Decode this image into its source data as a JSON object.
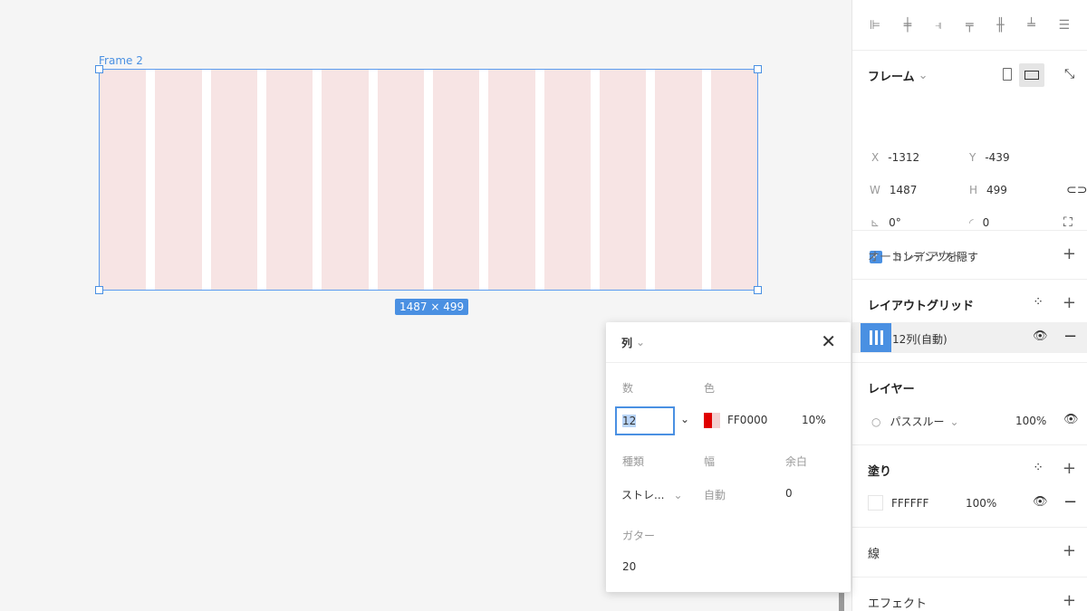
{
  "canvas": {
    "frame_name": "Frame 2",
    "dimensions": "1487 × 499",
    "columns": 12
  },
  "align_icons": [
    "align-left-icon",
    "align-center-h-icon",
    "align-right-icon",
    "align-top-icon",
    "align-center-v-icon",
    "align-bottom-icon",
    "distribute-icon"
  ],
  "frame_section": {
    "title": "フレーム",
    "x_label": "X",
    "x": "-1312",
    "y_label": "Y",
    "y": "-439",
    "w_label": "W",
    "w": "1487",
    "h_label": "H",
    "h": "499",
    "rotation": "0°",
    "radius": "0",
    "clip_label": "コンテンツを隠す"
  },
  "auto_layout": {
    "title": "オートレイアウト"
  },
  "layout_grid": {
    "title": "レイアウトグリッド",
    "item": "12列(自動)"
  },
  "layer": {
    "title": "レイヤー",
    "mode": "パススルー",
    "opacity": "100%"
  },
  "fill": {
    "title": "塗り",
    "color": "FFFFFF",
    "opacity": "100%"
  },
  "stroke": {
    "title": "線"
  },
  "effect": {
    "title": "エフェクト"
  },
  "popup": {
    "title": "列",
    "count_label": "数",
    "color_label": "色",
    "count_value": "12",
    "color_hex": "FF0000",
    "color_opacity": "10%",
    "type_label": "種類",
    "width_label": "幅",
    "margin_label": "余白",
    "type_value": "ストレ...",
    "width_value": "自動",
    "margin_value": "0",
    "gutter_label": "ガター",
    "gutter_value": "20"
  },
  "colors": {
    "accent": "#4a90e2",
    "grid": "#f7e4e4",
    "red": "#e00000"
  }
}
